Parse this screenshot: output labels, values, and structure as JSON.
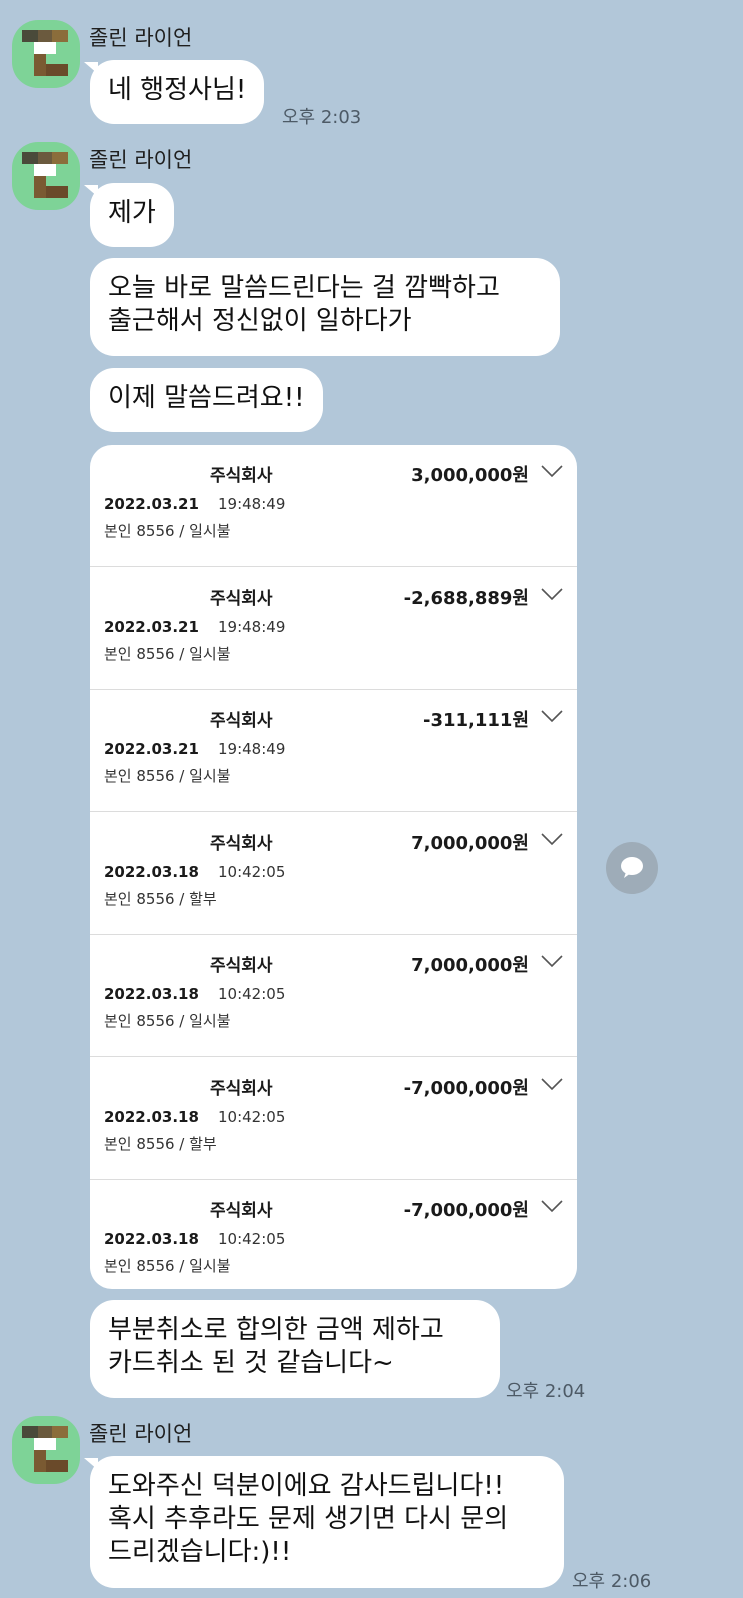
{
  "sender_name": "졸린 라이언",
  "groups": [
    {
      "bubbles": [
        "네 행정사님!"
      ],
      "time": "오후 2:03"
    },
    {
      "bubbles": [
        "제가",
        "오늘 바로 말씀드린다는 걸 깜빡하고\n출근해서 정신없이 일하다가",
        "이제 말씀드려요!!"
      ]
    },
    {
      "after_card_bubble": "부분취소로 합의한 금액 제하고\n카드취소 된 것 같습니다~",
      "time": "오후 2:04"
    },
    {
      "bubbles": [
        "도와주신 덕분이에요 감사드립니다!!\n혹시 추후라도 문제 생기면 다시 문의\n드리겠습니다:)!!"
      ],
      "time": "오후 2:06"
    }
  ],
  "transactions": [
    {
      "merchant": "주식회사",
      "amount": "3,000,000원",
      "date": "2022.03.21",
      "time": "19:48:49",
      "detail": "본인 8556 / 일시불"
    },
    {
      "merchant": "주식회사",
      "amount": "-2,688,889원",
      "date": "2022.03.21",
      "time": "19:48:49",
      "detail": "본인 8556 / 일시불"
    },
    {
      "merchant": "주식회사",
      "amount": "-311,111원",
      "date": "2022.03.21",
      "time": "19:48:49",
      "detail": "본인 8556 / 일시불"
    },
    {
      "merchant": "주식회사",
      "amount": "7,000,000원",
      "date": "2022.03.18",
      "time": "10:42:05",
      "detail": "본인 8556 / 할부"
    },
    {
      "merchant": "주식회사",
      "amount": "7,000,000원",
      "date": "2022.03.18",
      "time": "10:42:05",
      "detail": "본인 8556 / 일시불"
    },
    {
      "merchant": "주식회사",
      "amount": "-7,000,000원",
      "date": "2022.03.18",
      "time": "10:42:05",
      "detail": "본인 8556 / 할부"
    },
    {
      "merchant": "주식회사",
      "amount": "-7,000,000원",
      "date": "2022.03.18",
      "time": "10:42:05",
      "detail": "본인 8556 / 일시불"
    }
  ],
  "icons": {
    "avatar": "pixelated-avatar",
    "expand": "chevron-down-icon",
    "share": "speech-bubble-icon"
  },
  "colors": {
    "background": "#b2c7d9",
    "bubble": "#ffffff",
    "avatar": "#7ed397"
  }
}
